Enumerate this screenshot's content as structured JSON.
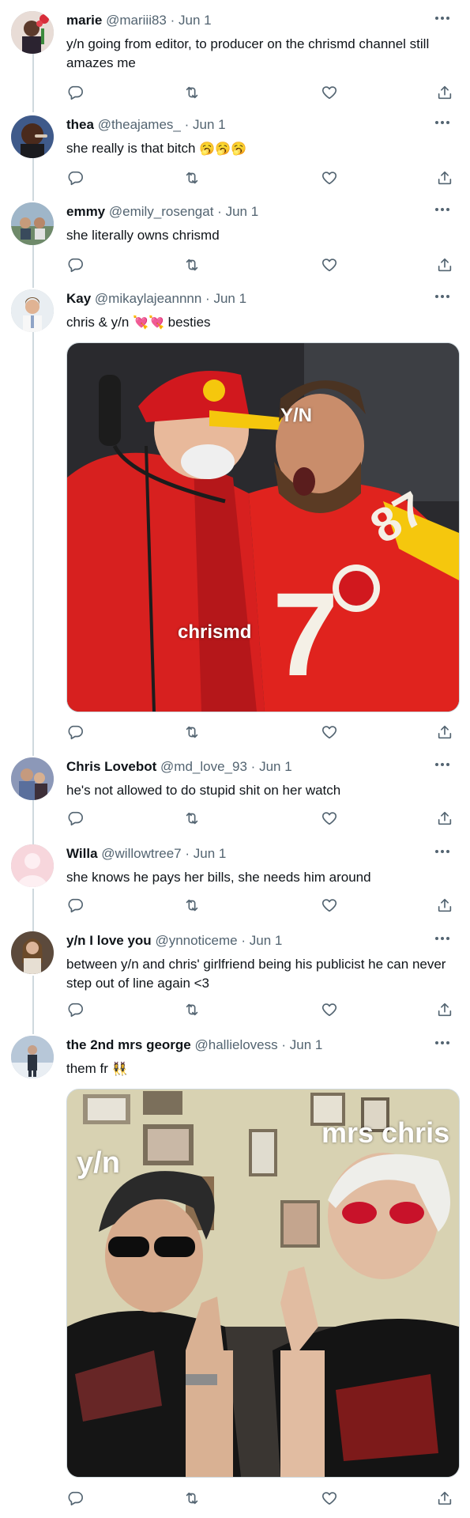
{
  "tweets": [
    {
      "name": "marie",
      "handle": "@mariii83",
      "date": "Jun 1",
      "text": "y/n going from editor, to producer on the chrismd channel still amazes me",
      "emoji": ""
    },
    {
      "name": "thea",
      "handle": "@theajames_",
      "date": "Jun 1",
      "text": "she really is that bitch",
      "emoji": "🥱🥱🥱"
    },
    {
      "name": "emmy",
      "handle": "@emily_rosengat",
      "date": "Jun 1",
      "text": "she literally owns chrismd",
      "emoji": ""
    },
    {
      "name": "Kay",
      "handle": "@mikaylajeannnn",
      "date": "Jun 1",
      "text": "chris & y/n",
      "text_after": "besties",
      "emoji": "💘💘",
      "media_captions": {
        "top": "Y/N",
        "bottom": "chrismd"
      }
    },
    {
      "name": "Chris Lovebot",
      "handle": "@md_love_93",
      "date": "Jun 1",
      "text": "he's not allowed to do stupid shit on her watch",
      "emoji": ""
    },
    {
      "name": "Willa",
      "handle": "@willowtree7",
      "date": "Jun 1",
      "text": "she knows he pays her bills, she needs him around",
      "emoji": ""
    },
    {
      "name": "y/n I love you",
      "handle": "@ynnoticeme",
      "date": "Jun 1",
      "text": "between y/n and chris' girlfriend being his publicist he can never step out of line again <3",
      "emoji": ""
    },
    {
      "name": "the 2nd mrs george",
      "handle": "@hallielovess",
      "date": "Jun 1",
      "text": "them fr",
      "emoji": "👯‍♀️",
      "media_captions": {
        "left": "y/n",
        "right": "mrs chris"
      }
    }
  ],
  "separator": "·",
  "icons": [
    "reply-icon",
    "retweet-icon",
    "like-icon",
    "share-icon",
    "more-icon"
  ],
  "colors": {
    "text": "#0f1419",
    "secondary": "#536471",
    "line": "#cfd9de"
  }
}
